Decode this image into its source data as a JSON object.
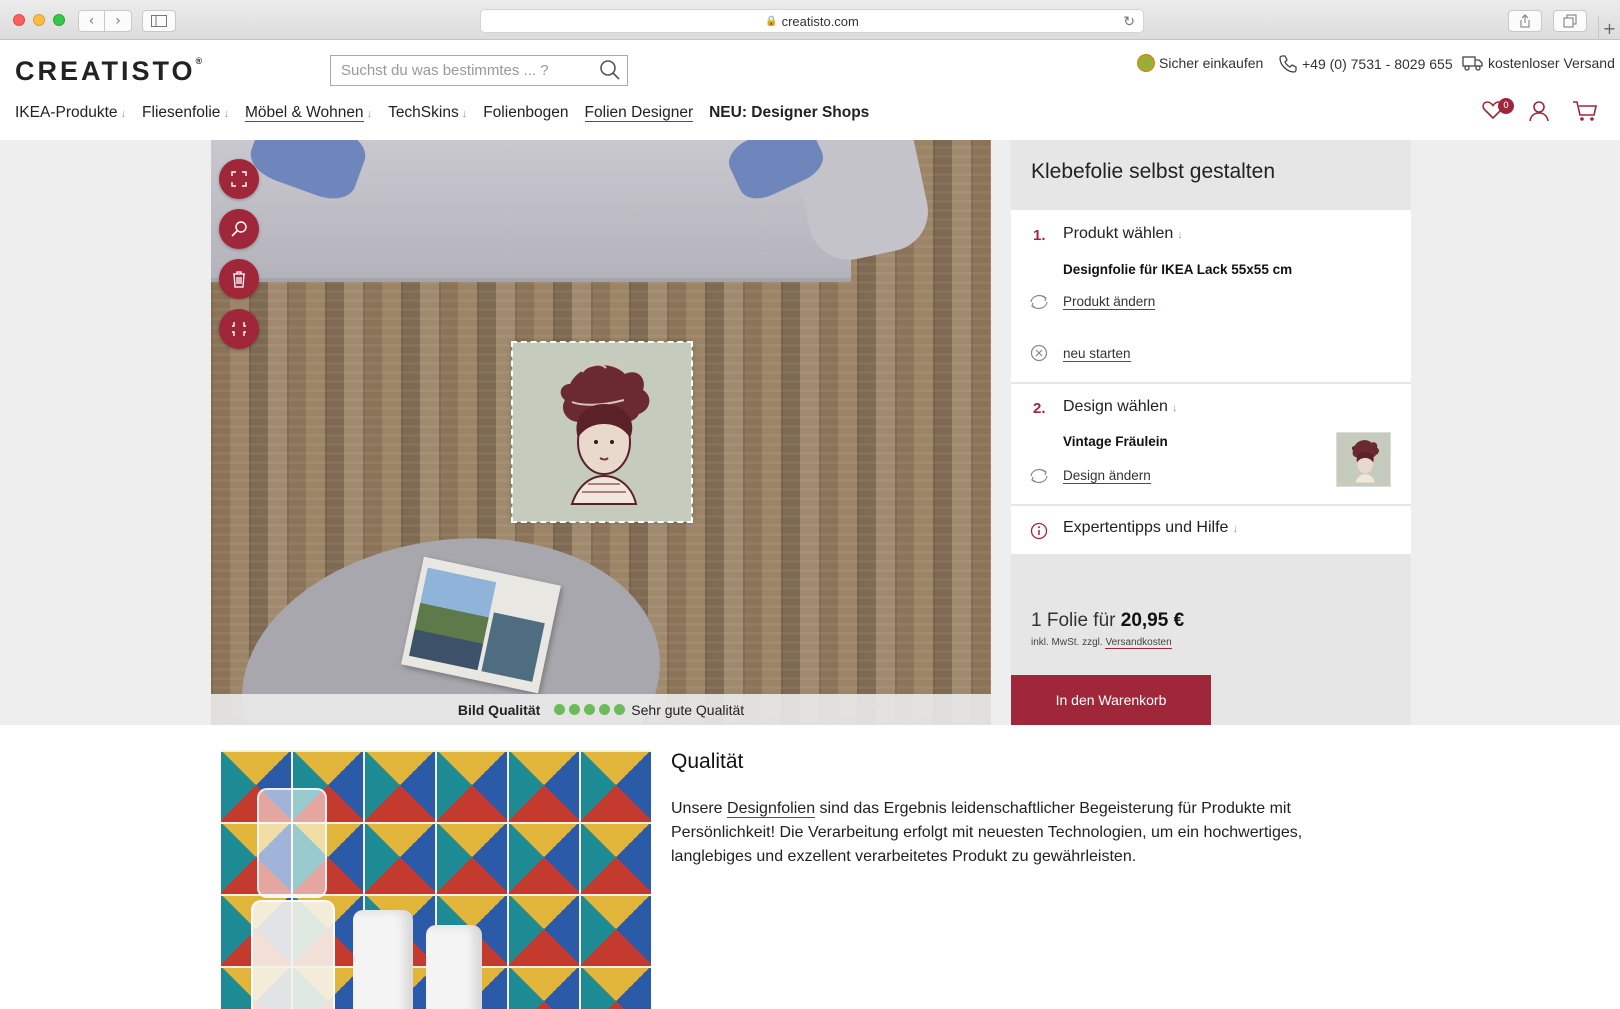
{
  "browser": {
    "url": "creatisto.com"
  },
  "header": {
    "logo": "CREATISTO",
    "logo_mark": "®",
    "search_placeholder": "Suchst du was bestimmtes ... ?",
    "trust_secure": "Sicher einkaufen",
    "trust_phone": "+49 (0) 7531 - 8029 655",
    "trust_shipping": "kostenloser Versand",
    "wishlist_count": "0"
  },
  "nav": {
    "items": [
      {
        "label": "IKEA-Produkte",
        "arrow": "↓"
      },
      {
        "label": "Fliesenfolie",
        "arrow": "↓"
      },
      {
        "label": "Möbel & Wohnen",
        "arrow": "↓"
      },
      {
        "label": "TechSkins",
        "arrow": "↓"
      },
      {
        "label": "Folienbogen",
        "arrow": ""
      },
      {
        "label": "Folien Designer",
        "arrow": ""
      },
      {
        "label": "NEU: Designer Shops",
        "arrow": ""
      }
    ]
  },
  "editor": {
    "quality_label": "Bild Qualität",
    "quality_value": "Sehr gute Qualität",
    "quality_dots": 5
  },
  "panel": {
    "title": "Klebefolie selbst gestalten",
    "step1": {
      "num": "1.",
      "title": "Produkt wählen",
      "arrow": "↓",
      "product": "Designfolie für IKEA Lack 55x55 cm",
      "change": "Produkt ändern",
      "restart": "neu starten"
    },
    "step2": {
      "num": "2.",
      "title": "Design wählen",
      "arrow": "↓",
      "design": "Vintage Fräulein",
      "change": "Design ändern"
    },
    "step3": {
      "title": "Expertentipps und Hilfe",
      "arrow": "↓"
    },
    "price_prefix": "1 Folie für",
    "price": "20,95 €",
    "price_note_prefix": "inkl. MwSt. zzgl.",
    "price_note_link": "Versandkosten",
    "cart_button": "In den Warenkorb"
  },
  "quality_section": {
    "title": "Qualität",
    "text_before": "Unsere ",
    "text_link": "Designfolien",
    "text_after": " sind das Ergebnis leidenschaftlicher Begeisterung für Produkte mit Persönlichkeit! Die Verarbeitung erfolgt mit neuesten Technologien, um ein hochwertiges, langlebiges und exzellent verarbeitetes Produkt zu gewährleisten."
  },
  "colors": {
    "accent": "#a0263a",
    "quality_dot": "#6cbb5a",
    "panel_bg": "#e6e6e6"
  }
}
